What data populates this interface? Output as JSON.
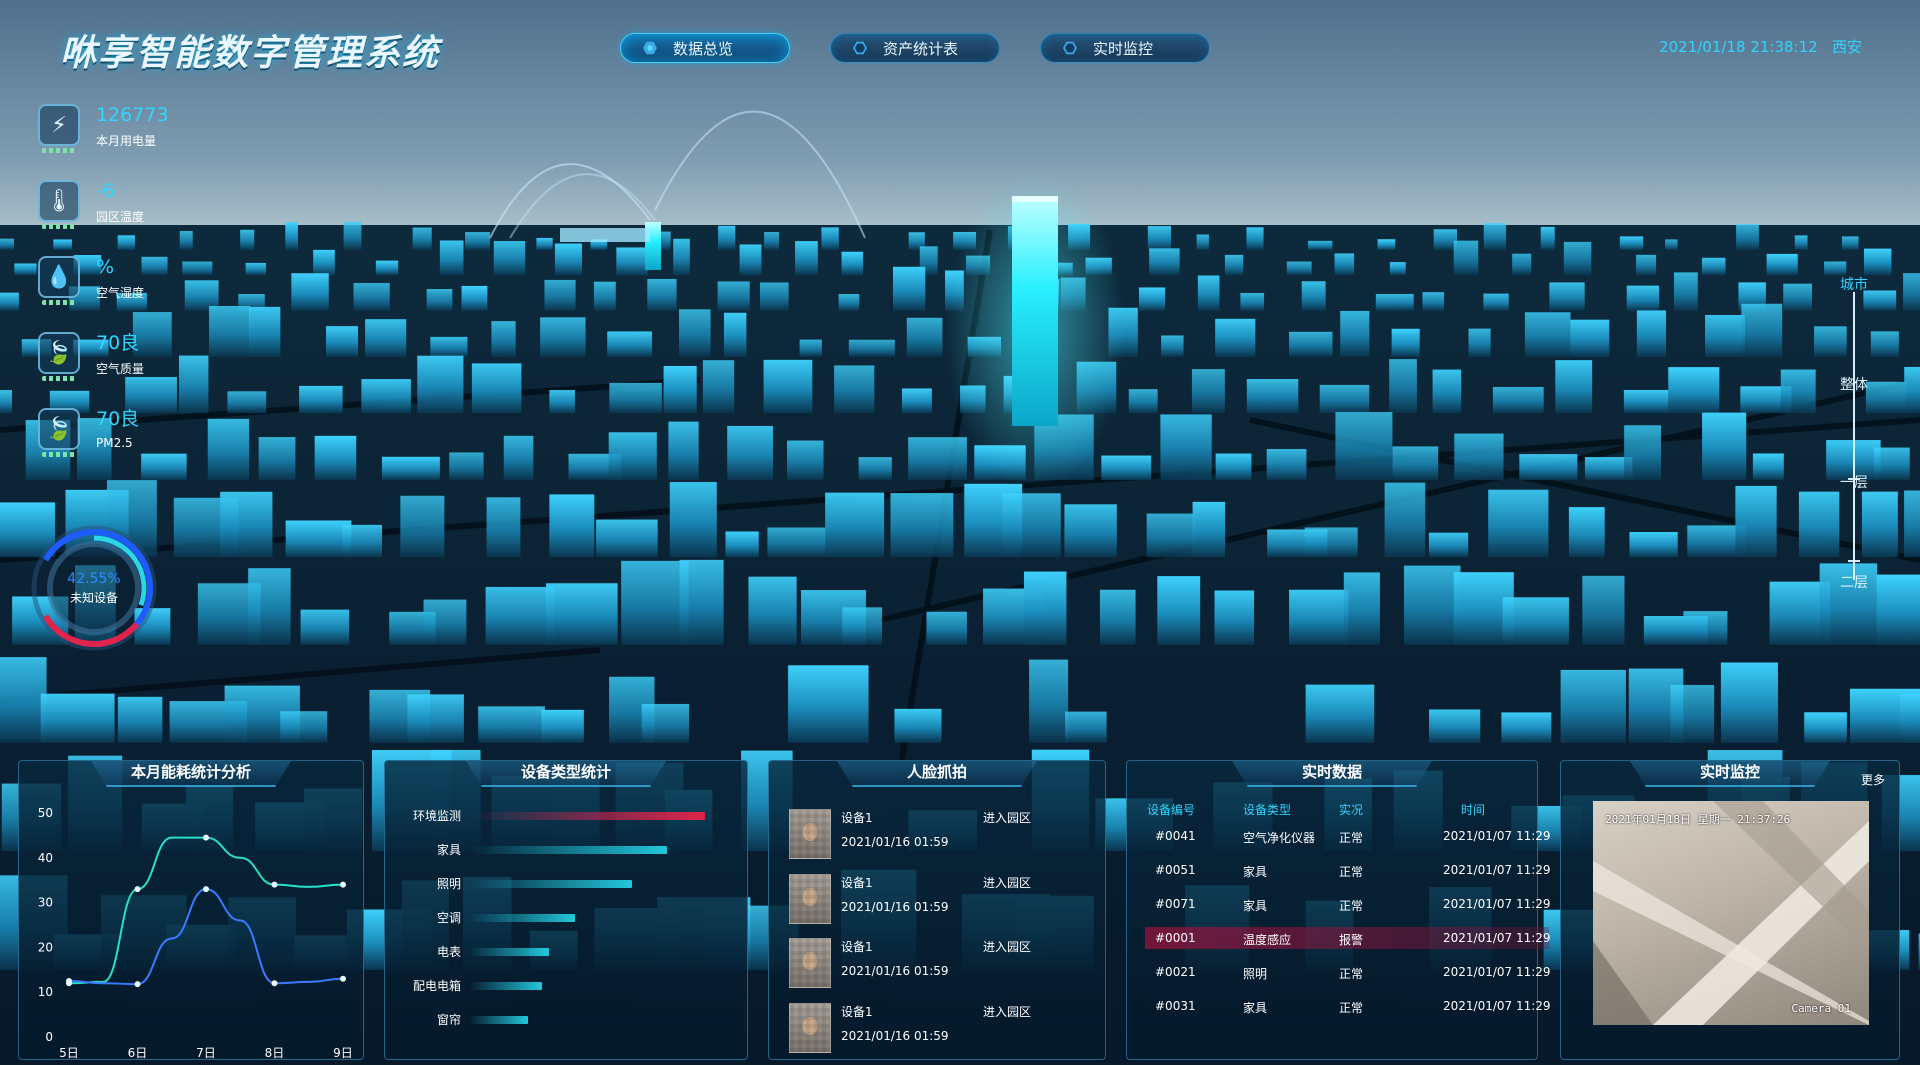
{
  "header": {
    "title": "咻享智能数字管理系统",
    "datetime": "2021/01/18 21:38:12",
    "city": "西安"
  },
  "nav": {
    "tabs": [
      {
        "label": "数据总览",
        "active": true
      },
      {
        "label": "资产统计表",
        "active": false
      },
      {
        "label": "实时监控",
        "active": false
      }
    ]
  },
  "metrics": [
    {
      "value": "126773",
      "label": "本月用电量",
      "icon": "lightning-icon"
    },
    {
      "value": "-6",
      "label": "园区温度",
      "icon": "thermometer-icon"
    },
    {
      "value": "%",
      "label": "空气湿度",
      "icon": "droplets-icon"
    },
    {
      "value": "70良",
      "label": "空气质量",
      "icon": "leaf-icon"
    },
    {
      "value": "70良",
      "label": "PM2.5",
      "icon": "leaf-icon"
    }
  ],
  "gauge": {
    "percent_text": "42.55%",
    "percent": 42.55,
    "label": "未知设备",
    "colors": {
      "blue": "#1f5cff",
      "red": "#e0244c",
      "cyan": "#2ad7e8"
    }
  },
  "levels": {
    "items": [
      {
        "label": "城市",
        "active": true
      },
      {
        "label": "整体",
        "active": false
      },
      {
        "label": "一层",
        "active": false
      },
      {
        "label": "二层",
        "active": false
      }
    ]
  },
  "energy_panel": {
    "title": "本月能耗统计分析"
  },
  "chart_data": {
    "type": "line",
    "title": "本月能耗统计分析",
    "categories": [
      "5日",
      "6日",
      "7日",
      "8日",
      "9日"
    ],
    "x": [
      5,
      5.5,
      6,
      6.5,
      7,
      7.5,
      8,
      8.5,
      9
    ],
    "ylim": [
      0,
      50
    ],
    "yticks": [
      0,
      10,
      20,
      30,
      40,
      50
    ],
    "series": [
      {
        "color": "#29e0c6",
        "values": [
          12,
          12.3,
          33,
          44.5,
          44.5,
          40,
          34,
          33.5,
          34
        ]
      },
      {
        "color": "#3a7bff",
        "values": [
          12.5,
          12,
          11.8,
          22,
          33,
          26,
          12,
          12.3,
          13
        ]
      }
    ],
    "grid": false
  },
  "device_panel": {
    "title": "设备类型统计",
    "bars": [
      {
        "label": "环境监测",
        "value": 100,
        "color": "#e0244c"
      },
      {
        "label": "家具",
        "value": 84,
        "color": "#22c8dc"
      },
      {
        "label": "照明",
        "value": 69,
        "color": "#22c8dc"
      },
      {
        "label": "空调",
        "value": 45,
        "color": "#22c8dc"
      },
      {
        "label": "电表",
        "value": 34,
        "color": "#22c8dc"
      },
      {
        "label": "配电电箱",
        "value": 31,
        "color": "#22c8dc"
      },
      {
        "label": "窗帘",
        "value": 25,
        "color": "#22c8dc"
      }
    ]
  },
  "face_panel": {
    "title": "人脸抓拍",
    "rows": [
      {
        "device": "设备1",
        "time": "2021/01/16 01:59",
        "action": "进入园区"
      },
      {
        "device": "设备1",
        "time": "2021/01/16 01:59",
        "action": "进入园区"
      },
      {
        "device": "设备1",
        "time": "2021/01/16 01:59",
        "action": "进入园区"
      },
      {
        "device": "设备1",
        "time": "2021/01/16 01:59",
        "action": "进入园区"
      }
    ]
  },
  "realtime_panel": {
    "title": "实时数据",
    "columns": [
      "设备编号",
      "设备类型",
      "实况",
      "时间"
    ],
    "rows": [
      {
        "id": "#0041",
        "type": "空气净化仪器",
        "status": "正常",
        "time": "2021/01/07 11:29",
        "alarm": false
      },
      {
        "id": "#0051",
        "type": "家具",
        "status": "正常",
        "time": "2021/01/07 11:29",
        "alarm": false
      },
      {
        "id": "#0071",
        "type": "家具",
        "status": "正常",
        "time": "2021/01/07 11:29",
        "alarm": false
      },
      {
        "id": "#0001",
        "type": "温度感应",
        "status": "报警",
        "time": "2021/01/07 11:29",
        "alarm": true
      },
      {
        "id": "#0021",
        "type": "照明",
        "status": "正常",
        "time": "2021/01/07 11:29",
        "alarm": false
      },
      {
        "id": "#0031",
        "type": "家具",
        "status": "正常",
        "time": "2021/01/07 11:29",
        "alarm": false
      }
    ]
  },
  "monitor_panel": {
    "title": "实时监控",
    "more_label": "更多",
    "camera_stamp": "2021年01月18日   星期一   21:37:26",
    "camera_label": "Camera 01"
  }
}
